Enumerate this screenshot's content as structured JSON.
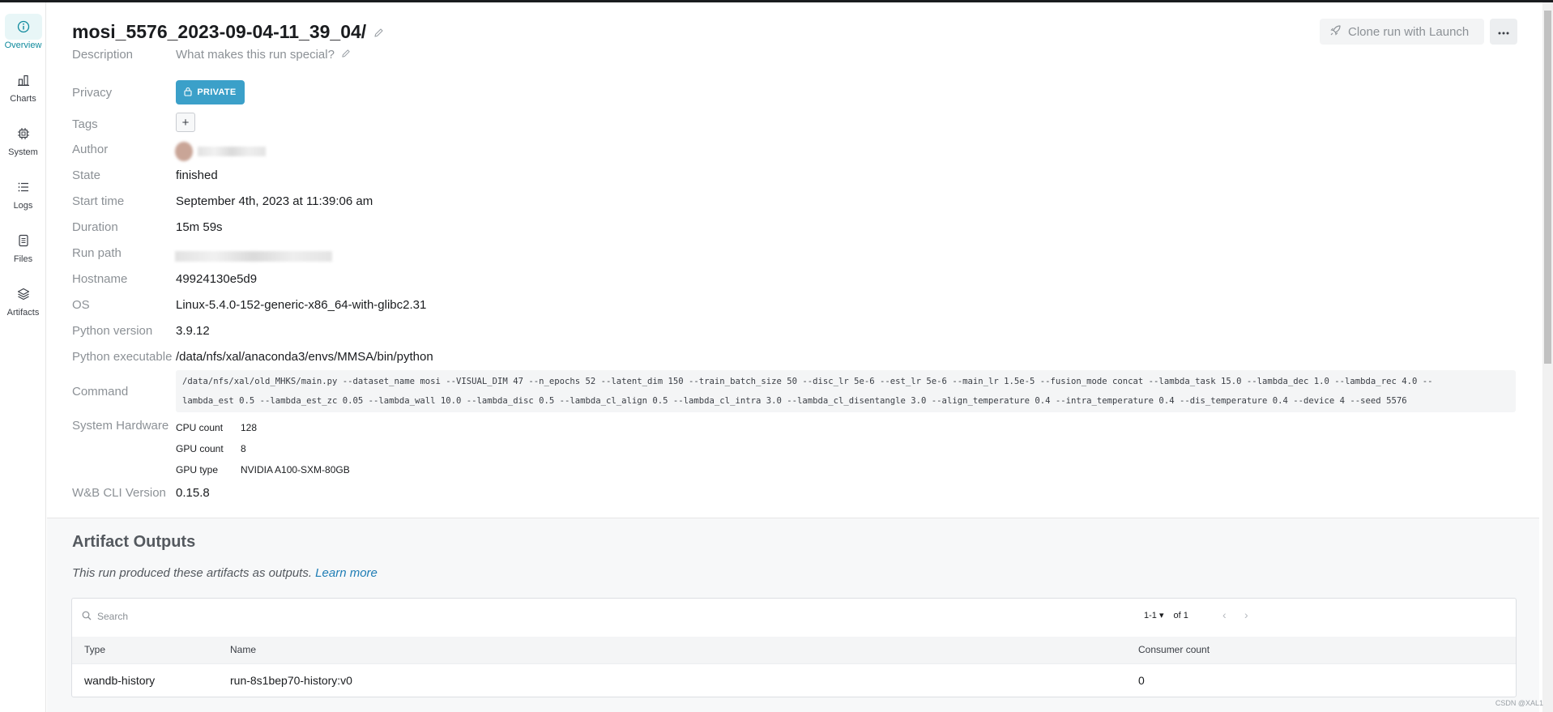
{
  "sidebar": {
    "items": [
      {
        "label": "Overview",
        "icon": "info-icon",
        "active": true
      },
      {
        "label": "Charts",
        "icon": "bar-chart-icon",
        "active": false
      },
      {
        "label": "System",
        "icon": "cpu-chip-icon",
        "active": false
      },
      {
        "label": "Logs",
        "icon": "list-icon",
        "active": false
      },
      {
        "label": "Files",
        "icon": "file-icon",
        "active": false
      },
      {
        "label": "Artifacts",
        "icon": "layers-icon",
        "active": false
      }
    ]
  },
  "header": {
    "title": "mosi_5576_2023-09-04-11_39_04/",
    "clone_label": "Clone run with Launch"
  },
  "overview": {
    "description_key": "Description",
    "description_placeholder": "What makes this run special?",
    "privacy_key": "Privacy",
    "privacy_value": "PRIVATE",
    "tags_key": "Tags",
    "tags_add": "+",
    "author_key": "Author",
    "state_key": "State",
    "state_value": "finished",
    "start_key": "Start time",
    "start_value": "September 4th, 2023 at 11:39:06 am",
    "duration_key": "Duration",
    "duration_value": "15m 59s",
    "runpath_key": "Run path",
    "hostname_key": "Hostname",
    "hostname_value": "49924130e5d9",
    "os_key": "OS",
    "os_value": "Linux-5.4.0-152-generic-x86_64-with-glibc2.31",
    "pyver_key": "Python version",
    "pyver_value": "3.9.12",
    "pyexe_key": "Python executable",
    "pyexe_value": "/data/nfs/xal/anaconda3/envs/MMSA/bin/python",
    "command_key": "Command",
    "command_line1": "/data/nfs/xal/old_MHKS/main.py --dataset_name mosi --VISUAL_DIM 47 --n_epochs 52 --latent_dim 150 --train_batch_size 50 --disc_lr 5e-6 --est_lr 5e-6 --main_lr 1.5e-5 --fusion_mode concat --lambda_task 15.0 --lambda_dec 1.0 --lambda_rec 4.0 --",
    "command_line2": "lambda_est 0.5 --lambda_est_zc 0.05 --lambda_wall 10.0 --lambda_disc 0.5 --lambda_cl_align 0.5 --lambda_cl_intra 3.0 --lambda_cl_disentangle 3.0 --align_temperature 0.4 --intra_temperature 0.4 --dis_temperature 0.4 --device 4 --seed 5576",
    "hardware_key": "System Hardware",
    "hardware": [
      {
        "k": "CPU count",
        "v": "128"
      },
      {
        "k": "GPU count",
        "v": "8"
      },
      {
        "k": "GPU type",
        "v": "NVIDIA A100-SXM-80GB"
      }
    ],
    "cli_key": "W&B CLI Version",
    "cli_value": "0.15.8"
  },
  "artifacts": {
    "title": "Artifact Outputs",
    "subtitle": "This run produced these artifacts as outputs.",
    "learn_more": "Learn more",
    "search_placeholder": "Search",
    "pager_range": "1-1",
    "pager_of": "of 1",
    "columns": [
      "Type",
      "Name",
      "Consumer count"
    ],
    "rows": [
      {
        "type": "wandb-history",
        "name": "run-8s1bep70-history:v0",
        "consumers": "0"
      }
    ]
  },
  "watermark": "CSDN @XAL1",
  "colors": {
    "accent": "#0f8a9d",
    "private": "#3ba0c9",
    "link": "#1f7db5"
  }
}
